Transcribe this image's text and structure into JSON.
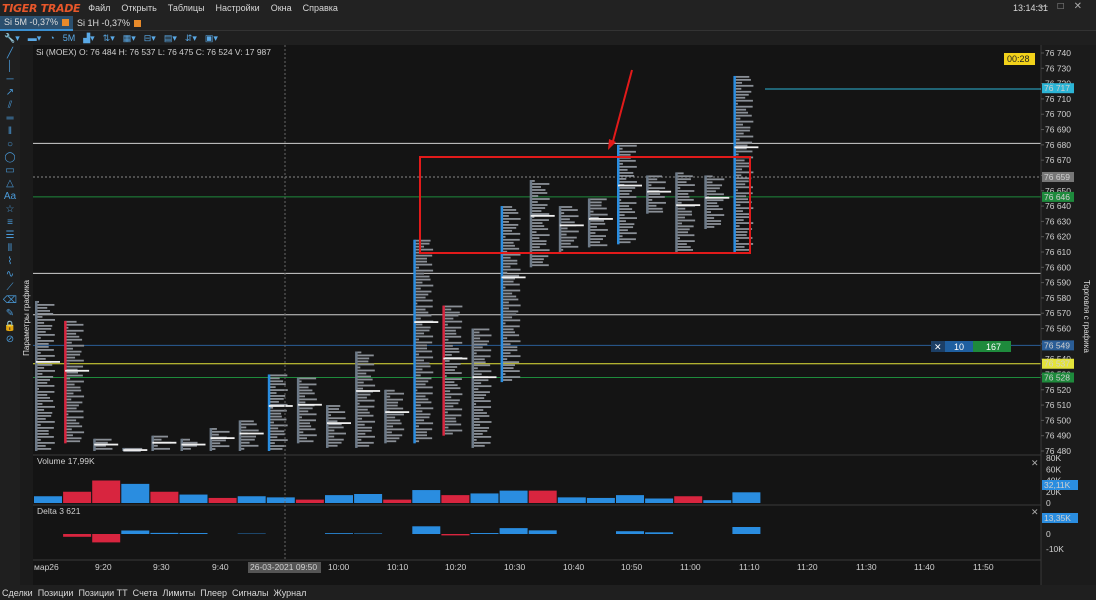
{
  "app": {
    "logo": "TIGER TRADE",
    "clock": "13:14:31"
  },
  "menu": [
    "Файл",
    "Открыть",
    "Таблицы",
    "Настройки",
    "Окна",
    "Справка"
  ],
  "tabs": [
    {
      "label": "Si 5M -0,37%",
      "active": true
    },
    {
      "label": "Si 1H -0,37%",
      "active": false
    }
  ],
  "toolbar": {
    "timeframe": "5M"
  },
  "chart": {
    "info": "Si (MOEX) O: 76 484  H: 76 537  L: 76 475  C: 76 524  V: 17 987",
    "timer": "00:28",
    "left_label": "Параметры графика",
    "right_label": "Торговля с графика",
    "order_widget": {
      "qty": "10",
      "value": "167"
    },
    "price_ticks": [
      "76 740",
      "76 730",
      "76 720",
      "76 710",
      "76 700",
      "76 690",
      "76 680",
      "76 670",
      "76 660",
      "76 650",
      "76 640",
      "76 630",
      "76 620",
      "76 610",
      "76 600",
      "76 590",
      "76 580",
      "76 570",
      "76 560",
      "76 550",
      "76 540",
      "76 530",
      "76 520",
      "76 510",
      "76 500",
      "76 490",
      "76 480"
    ],
    "price_labels": [
      {
        "text": "76 717",
        "price": 76717,
        "color": "#2cb5d6",
        "fg": "#0a2a35"
      },
      {
        "text": "76 659",
        "price": 76659,
        "color": "#777777",
        "fg": "#ffffff"
      },
      {
        "text": "76 646",
        "price": 76646,
        "color": "#1e8a3c",
        "fg": "#ffffff"
      },
      {
        "text": "76 549",
        "price": 76549,
        "color": "#2a5d96",
        "fg": "#ffffff"
      },
      {
        "text": "76 537",
        "price": 76537,
        "color": "#e4e43a",
        "fg": "#222222"
      },
      {
        "text": "76 528",
        "price": 76528,
        "color": "#1e8a3c",
        "fg": "#ffffff"
      }
    ],
    "time_labels": [
      "мар26",
      "9:20",
      "9:30",
      "9:40",
      "26-03-2021 09:50",
      "10:00",
      "10:10",
      "10:20",
      "10:30",
      "10:40",
      "10:50",
      "11:00",
      "11:10",
      "11:20",
      "11:30",
      "11:40",
      "11:50"
    ]
  },
  "volume": {
    "title": "Volume 17,99K",
    "ticks": [
      "80K",
      "60K",
      "40K",
      "20K",
      "0"
    ],
    "label": "32,11K"
  },
  "delta": {
    "title": "Delta 3 621",
    "ticks": [
      "10K",
      "0",
      "-10K"
    ],
    "label": "13,35K"
  },
  "chart_data": {
    "type": "bar",
    "volume": [
      {
        "v": 12,
        "c": "blue"
      },
      {
        "v": 20,
        "c": "red"
      },
      {
        "v": 40,
        "c": "red"
      },
      {
        "v": 34,
        "c": "blue"
      },
      {
        "v": 20,
        "c": "red"
      },
      {
        "v": 15,
        "c": "blue"
      },
      {
        "v": 9,
        "c": "red"
      },
      {
        "v": 12,
        "c": "blue"
      },
      {
        "v": 10,
        "c": "blue"
      },
      {
        "v": 6,
        "c": "red"
      },
      {
        "v": 14,
        "c": "blue"
      },
      {
        "v": 16,
        "c": "blue"
      },
      {
        "v": 6,
        "c": "red"
      },
      {
        "v": 23,
        "c": "blue"
      },
      {
        "v": 14,
        "c": "red"
      },
      {
        "v": 17,
        "c": "blue"
      },
      {
        "v": 22,
        "c": "blue"
      },
      {
        "v": 22,
        "c": "red"
      },
      {
        "v": 10,
        "c": "blue"
      },
      {
        "v": 9,
        "c": "blue"
      },
      {
        "v": 14,
        "c": "blue"
      },
      {
        "v": 8,
        "c": "blue"
      },
      {
        "v": 12,
        "c": "red"
      },
      {
        "v": 5,
        "c": "blue"
      },
      {
        "v": 19,
        "c": "blue"
      }
    ],
    "delta": [
      {
        "v": 0
      },
      {
        "v": -2000
      },
      {
        "v": -6000
      },
      {
        "v": 2500
      },
      {
        "v": 800
      },
      {
        "v": 700
      },
      {
        "v": 0
      },
      {
        "v": 300
      },
      {
        "v": 0
      },
      {
        "v": 0
      },
      {
        "v": 600
      },
      {
        "v": 400
      },
      {
        "v": 0
      },
      {
        "v": 5500
      },
      {
        "v": -1000
      },
      {
        "v": 700
      },
      {
        "v": 4200
      },
      {
        "v": 2600
      },
      {
        "v": 0
      },
      {
        "v": 0
      },
      {
        "v": 2000
      },
      {
        "v": 1200
      },
      {
        "v": 0
      },
      {
        "v": 0
      },
      {
        "v": 5000
      }
    ],
    "candles": [
      {
        "lo": 76480,
        "hi": 76578,
        "c": "grey"
      },
      {
        "lo": 76485,
        "hi": 76565,
        "c": "red"
      },
      {
        "lo": 76480,
        "hi": 76488,
        "c": "grey"
      },
      {
        "lo": 76480,
        "hi": 76482,
        "c": "grey"
      },
      {
        "lo": 76480,
        "hi": 76490,
        "c": "grey"
      },
      {
        "lo": 76480,
        "hi": 76488,
        "c": "grey"
      },
      {
        "lo": 76480,
        "hi": 76495,
        "c": "grey"
      },
      {
        "lo": 76480,
        "hi": 76500,
        "c": "grey"
      },
      {
        "lo": 76480,
        "hi": 76530,
        "c": "blue"
      },
      {
        "lo": 76485,
        "hi": 76528,
        "c": "grey"
      },
      {
        "lo": 76482,
        "hi": 76510,
        "c": "grey"
      },
      {
        "lo": 76482,
        "hi": 76545,
        "c": "grey"
      },
      {
        "lo": 76485,
        "hi": 76520,
        "c": "grey"
      },
      {
        "lo": 76485,
        "hi": 76618,
        "c": "blue"
      },
      {
        "lo": 76490,
        "hi": 76575,
        "c": "red"
      },
      {
        "lo": 76482,
        "hi": 76560,
        "c": "grey"
      },
      {
        "lo": 76525,
        "hi": 76640,
        "c": "blue"
      },
      {
        "lo": 76600,
        "hi": 76657,
        "c": "grey"
      },
      {
        "lo": 76610,
        "hi": 76640,
        "c": "grey"
      },
      {
        "lo": 76613,
        "hi": 76645,
        "c": "grey"
      },
      {
        "lo": 76615,
        "hi": 76680,
        "c": "blue"
      },
      {
        "lo": 76635,
        "hi": 76660,
        "c": "grey"
      },
      {
        "lo": 76610,
        "hi": 76662,
        "c": "grey"
      },
      {
        "lo": 76625,
        "hi": 76660,
        "c": "grey"
      },
      {
        "lo": 76610,
        "hi": 76725,
        "c": "blue"
      }
    ],
    "hlines": [
      76681,
      76659,
      76646,
      76596,
      76569,
      76549,
      76537,
      76528
    ],
    "highlight_box": {
      "from": 76673,
      "to": 76611
    }
  }
}
